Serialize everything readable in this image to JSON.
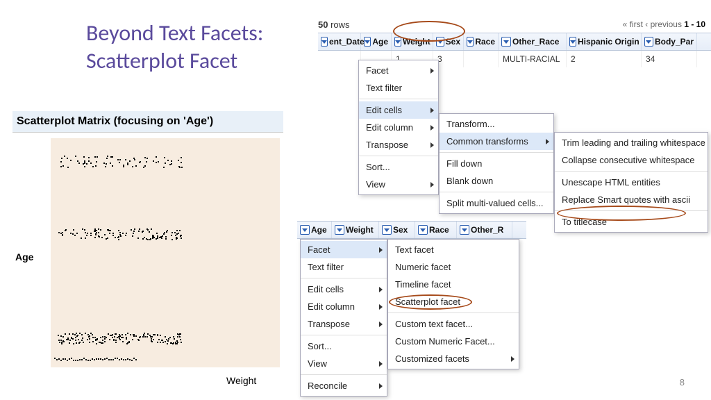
{
  "title_line1": "Beyond Text Facets:",
  "title_line2": "Scatterplot Facet",
  "matrix_title": "Scatterplot Matrix (focusing on 'Age')",
  "matrix_y": "Age",
  "matrix_x": "Weight",
  "rows_count": "50",
  "rows_word": " rows",
  "pager_prefix": "« first ‹ previous ",
  "pager_bold": "1 - 10",
  "cols_top": [
    "ent_Date",
    "Age",
    "Weight",
    "Sex",
    "Race",
    "Other_Race",
    "Hispanic Origin",
    "Body_Par"
  ],
  "data_top": [
    "1",
    "3",
    "",
    "MULTI-RACIAL",
    "2",
    "34"
  ],
  "menu1": {
    "items": [
      "Facet",
      "Text filter"
    ],
    "items2": [
      "Edit cells",
      "Edit column",
      "Transpose"
    ],
    "items3": [
      "Sort...",
      "View"
    ]
  },
  "submenu1": {
    "items": [
      "Transform...",
      "Common transforms"
    ],
    "items2": [
      "Fill down",
      "Blank down"
    ],
    "items3": [
      "Split multi-valued cells..."
    ]
  },
  "submenu2": {
    "items": [
      "Trim leading and trailing whitespace",
      "Collapse consecutive whitespace"
    ],
    "items2": [
      "Unescape HTML entities",
      "Replace Smart quotes with ascii"
    ],
    "items3": [
      "To titlecase"
    ]
  },
  "cols_mid": [
    "Age",
    "Weight",
    "Sex",
    "Race",
    "Other_R"
  ],
  "menu2": {
    "items": [
      "Facet",
      "Text filter"
    ],
    "items2": [
      "Edit cells",
      "Edit column",
      "Transpose"
    ],
    "items3": [
      "Sort...",
      "View"
    ],
    "items4": [
      "Reconcile"
    ]
  },
  "submenu_facet": {
    "items": [
      "Text facet",
      "Numeric facet",
      "Timeline facet",
      "Scatterplot facet"
    ],
    "items2": [
      "Custom text facet...",
      "Custom Numeric Facet...",
      "Customized facets"
    ]
  },
  "page_number": "8"
}
